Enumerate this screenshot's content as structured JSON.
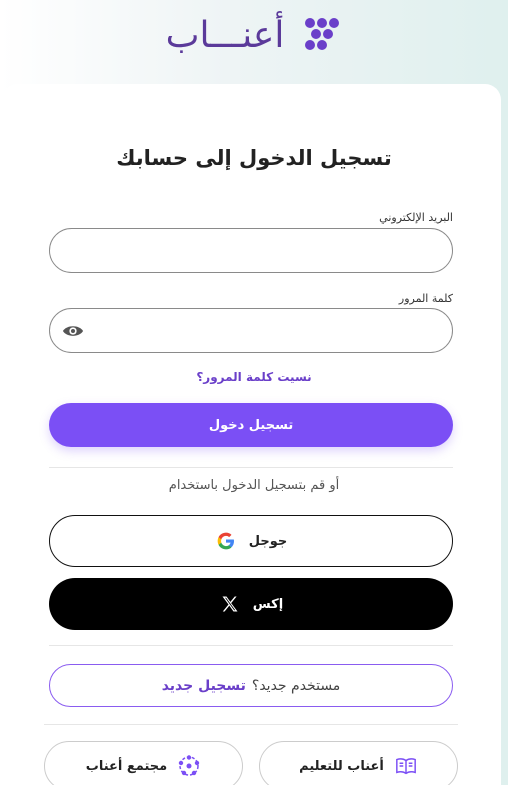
{
  "brand": {
    "name": "أعنـــاب",
    "color": "#5b3a9a"
  },
  "login": {
    "title": "تسجيل الدخول إلى حسابك",
    "email_label": "البريد الإلكتروني",
    "email_value": "",
    "password_label": "كلمة المرور",
    "password_value": "",
    "forgot_link": "نسيت كلمة المرور؟",
    "submit_label": "تسجيل دخول",
    "or_text": "أو قم بتسجيل الدخول باستخدام"
  },
  "social": {
    "google_label": "جوجل",
    "x_label": "إكس"
  },
  "register": {
    "question": "مستخدم جديد؟",
    "link": "تسجيل جديد"
  },
  "footer": {
    "learn_label": "أعناب للتعليم",
    "community_label": "مجتمع أعناب"
  },
  "colors": {
    "accent": "#7b4ff5",
    "link": "#6a3fc9"
  },
  "icons": [
    "grape-logo-icon",
    "eye-icon",
    "google-icon",
    "x-icon",
    "book-icon",
    "community-icon"
  ]
}
